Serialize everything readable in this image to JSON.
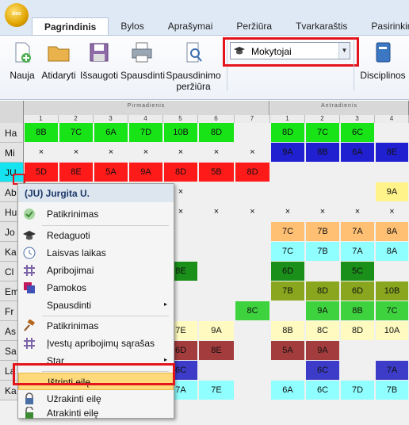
{
  "app": {
    "logo_text": "asc"
  },
  "tabs": [
    "Pagrindinis",
    "Bylos",
    "Aprašymai",
    "Peržiūra",
    "Tvarkaraštis",
    "Pasirinkimai"
  ],
  "ribbon": {
    "buttons": [
      "Nauja",
      "Atidaryti",
      "Išsaugoti",
      "Spausdinti"
    ],
    "print_preview": [
      "Spausdinimo",
      "peržiūra"
    ],
    "combo_value": "Mokytojai",
    "right_button": "Disciplinos"
  },
  "grid": {
    "days": [
      "Pirmadienis",
      "Antradienis"
    ],
    "day1_cols": [
      "1",
      "2",
      "3",
      "4",
      "5",
      "6",
      "7"
    ],
    "day2_cols": [
      "1",
      "2",
      "3",
      "4"
    ],
    "rows": [
      "Ha",
      "Mi",
      "JU",
      "Ab",
      "Hu",
      "Jo",
      "Ka",
      "Cl",
      "Em",
      "Fr",
      "As",
      "Sa",
      "La",
      "Ka"
    ],
    "cells": [
      [
        "8B",
        "7C",
        "6A",
        "7D",
        "10B",
        "8D",
        "",
        "8D",
        "7C",
        "6C",
        ""
      ],
      [
        "×",
        "×",
        "×",
        "×",
        "×",
        "×",
        "×",
        "9A",
        "8B",
        "6A",
        "8E"
      ],
      [
        "5D",
        "8E",
        "5A",
        "9A",
        "8D",
        "5B",
        "8D",
        "",
        "",
        "",
        ""
      ],
      [
        "",
        "",
        "",
        "",
        "×",
        "",
        "",
        "",
        "",
        "",
        "9A"
      ],
      [
        "",
        "",
        "",
        "",
        "×",
        "×",
        "×",
        "×",
        "×",
        "×",
        "×"
      ],
      [
        "",
        "",
        "",
        "",
        "",
        "",
        "",
        "7C",
        "7B",
        "7A",
        "8A"
      ],
      [
        "",
        "",
        "",
        "",
        "",
        "",
        "",
        "7C",
        "7B",
        "7A",
        "8A"
      ],
      [
        "",
        "",
        "",
        "",
        "8E",
        "",
        "",
        "6D",
        "",
        "5C",
        ""
      ],
      [
        "",
        "",
        "",
        "",
        "",
        "",
        "",
        "7B",
        "8D",
        "6D",
        "10B"
      ],
      [
        "",
        "",
        "",
        "",
        "",
        "",
        "8C",
        "",
        "9A",
        "8B",
        "7C"
      ],
      [
        "",
        "",
        "",
        "",
        "7E",
        "9A",
        "",
        "8B",
        "8C",
        "8D",
        "10A"
      ],
      [
        "",
        "",
        "",
        "",
        "6D",
        "8E",
        "",
        "5A",
        "9A",
        "",
        ""
      ],
      [
        "",
        "",
        "",
        "",
        "6C",
        "",
        "",
        "",
        "6C",
        "",
        "7A"
      ],
      [
        "",
        "",
        "",
        "",
        "7A",
        "7E",
        "",
        "6A",
        "6C",
        "7D",
        "7B"
      ]
    ]
  },
  "context_menu": {
    "header": "(JU) Jurgita U.",
    "items": [
      "Patikrinimas",
      "Redaguoti",
      "Laisvas laikas",
      "Apribojimai",
      "Pamokos",
      "Spausdinti",
      "Patikrinimas",
      "Įvestų apribojimų sąrašas",
      "Star",
      "Ištrinti eilę",
      "Užrakinti eilę",
      "Atrakinti eilę"
    ],
    "submenu_marker": "▸"
  },
  "colors": {
    "accent": "#e3141b",
    "selected": "#ffd97a"
  }
}
